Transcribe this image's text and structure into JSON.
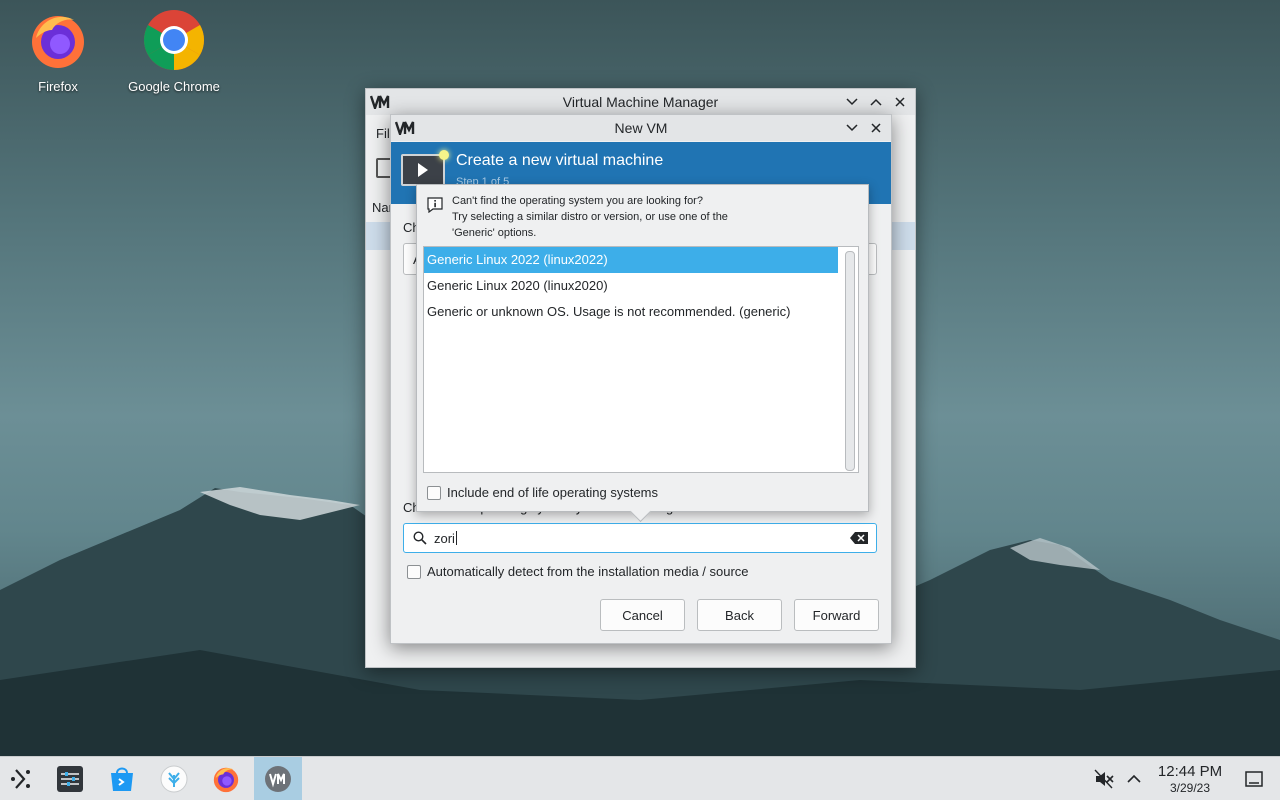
{
  "desktop": {
    "icons": [
      {
        "label": "Firefox"
      },
      {
        "label": "Google Chrome"
      }
    ]
  },
  "vmm_window": {
    "title": "Virtual Machine Manager",
    "menu_fragment": "File",
    "column_fragment": "Nam"
  },
  "dialog": {
    "title": "New VM",
    "banner_title": "Create a new virtual machine",
    "banner_subtitle": "Step 1 of 5",
    "fragment_ch": "Ch",
    "fragment_a": "A",
    "os_label": "Choose the operating system you are installing:",
    "search_value": "zori",
    "auto_detect_label": "Automatically detect from the installation media / source",
    "auto_detect_checked": false,
    "buttons": {
      "cancel": "Cancel",
      "back": "Back",
      "forward": "Forward"
    }
  },
  "popup": {
    "hint_line1": "Can't find the operating system you are looking for?",
    "hint_line2": "Try selecting a similar distro or version, or use one of the",
    "hint_line3": "'Generic' options.",
    "os_items": [
      {
        "label": "Generic Linux 2022 (linux2022)",
        "selected": true
      },
      {
        "label": "Generic Linux 2020 (linux2020)",
        "selected": false
      },
      {
        "label": "Generic or unknown OS. Usage is not recommended. (generic)",
        "selected": false
      }
    ],
    "eol_label": "Include end of life operating systems",
    "eol_checked": false
  },
  "taskbar": {
    "items": [
      "application-launcher-icon",
      "settings-icon",
      "discover-store-icon",
      "kde-connect-icon",
      "firefox-icon",
      "virt-manager-icon"
    ],
    "active_item": "virt-manager-icon",
    "time": "12:44 PM",
    "date": "3/29/23"
  },
  "colors": {
    "accent": "#3daee9",
    "banner": "#2074b3",
    "selected_row": "#3daee9"
  }
}
